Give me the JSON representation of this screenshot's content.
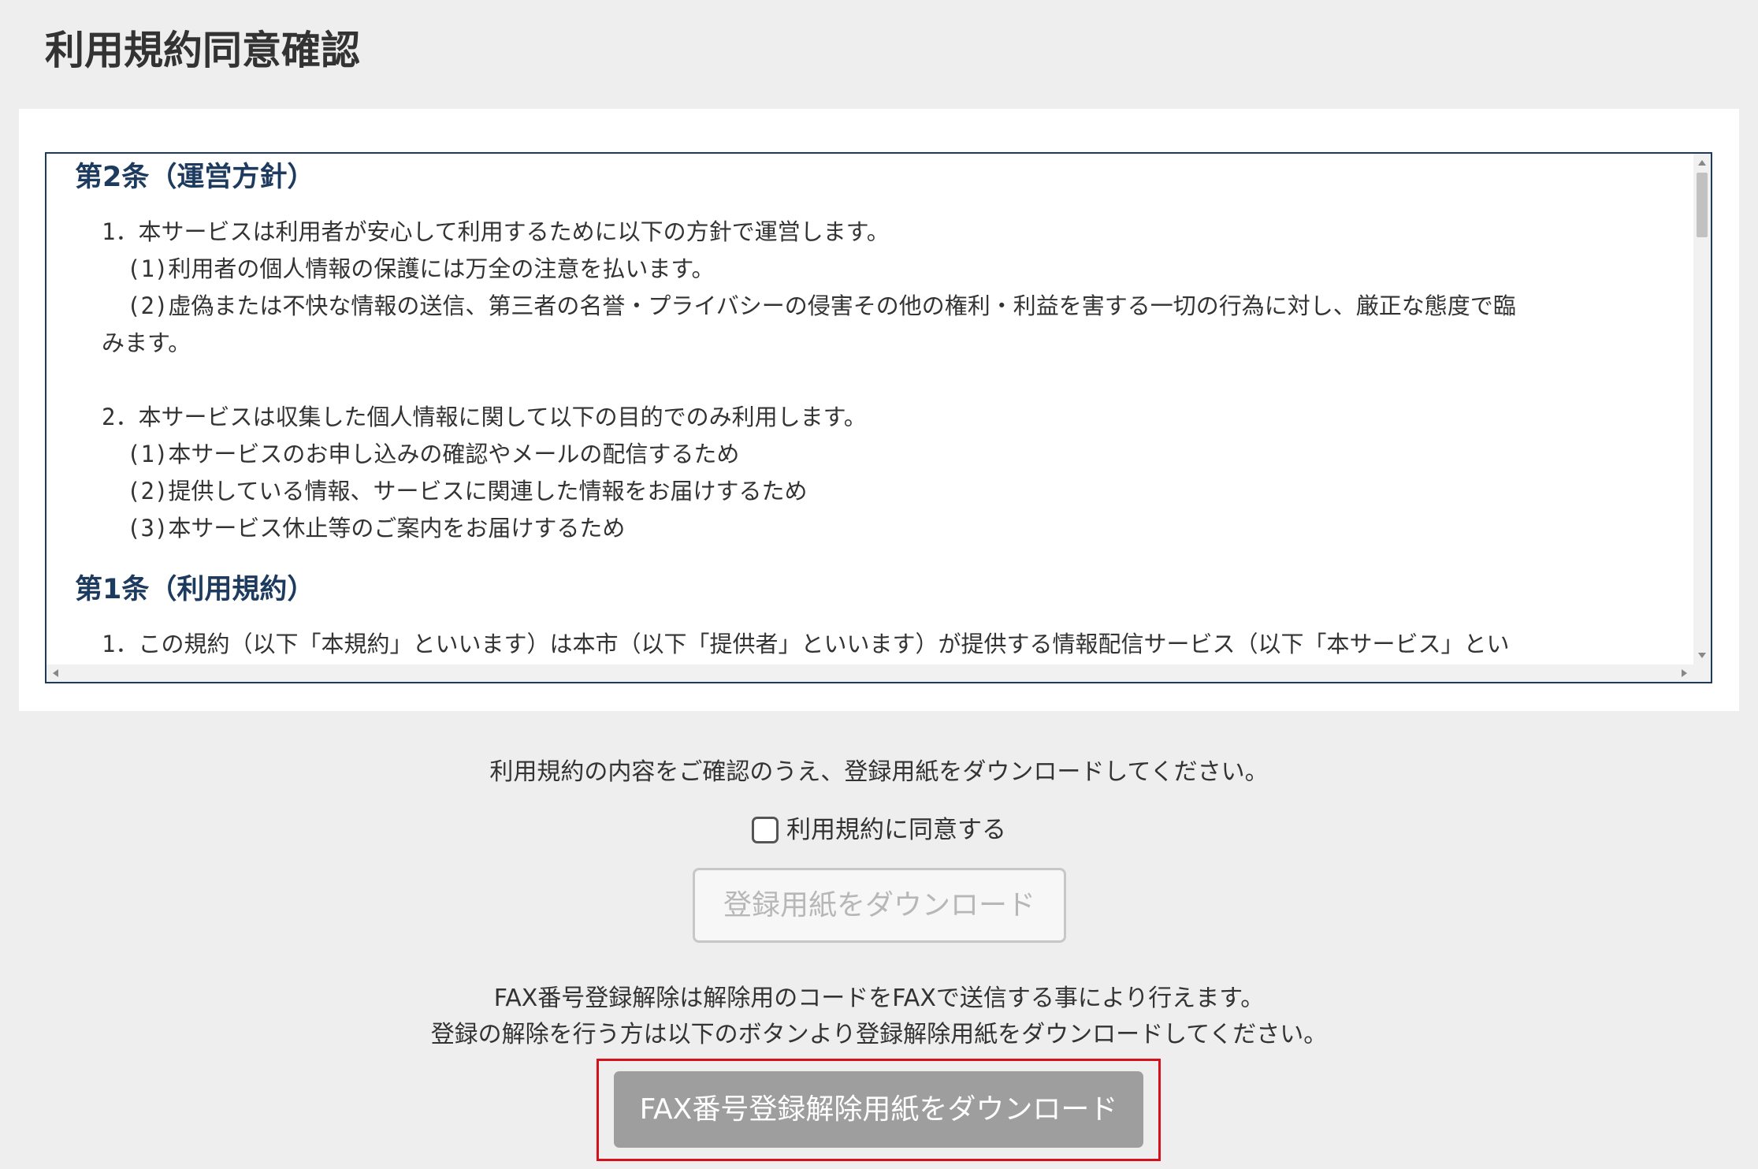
{
  "page": {
    "title": "利用規約同意確認"
  },
  "terms": {
    "article2": {
      "title": "第2条（運営方針）",
      "clause1": {
        "line": "1．本サービスは利用者が安心して利用するために以下の方針で運営します。",
        "sub1": "(1)利用者の個人情報の保護には万全の注意を払います。",
        "sub2": "(2)虚偽または不快な情報の送信、第三者の名誉・プライバシーの侵害その他の権利・利益を害する一切の行為に対し、厳正な態度で臨",
        "sub2_cont": "みます。"
      },
      "clause2": {
        "line": "2．本サービスは収集した個人情報に関して以下の目的でのみ利用します。",
        "sub1": "(1)本サービスのお申し込みの確認やメールの配信するため",
        "sub2": "(2)提供している情報、サービスに関連した情報をお届けするため",
        "sub3": "(3)本サービス休止等のご案内をお届けするため"
      }
    },
    "article1": {
      "title": "第1条（利用規約）",
      "clause1_partial": "1．この規約（以下「本規約」といいます）は本市（以下「提供者」といいます）が提供する情報配信サービス（以下「本サービス」とい"
    }
  },
  "agreement": {
    "instruction": "利用規約の内容をご確認のうえ、登録用紙をダウンロードしてください。",
    "checkbox_label": "利用規約に同意する",
    "checked": false,
    "download_button": "登録用紙をダウンロード"
  },
  "fax": {
    "info_line1": "FAX番号登録解除は解除用のコードをFAXで送信する事により行えます。",
    "info_line2": "登録の解除を行う方は以下のボタンより登録解除用紙をダウンロードしてください。",
    "button": "FAX番号登録解除用紙をダウンロード"
  },
  "colors": {
    "background": "#eeeeee",
    "heading_navy": "#1d3a5f",
    "disabled_text": "#b7b7b7",
    "fax_button_bg": "#9e9e9e",
    "highlight_red": "#d7111c"
  }
}
